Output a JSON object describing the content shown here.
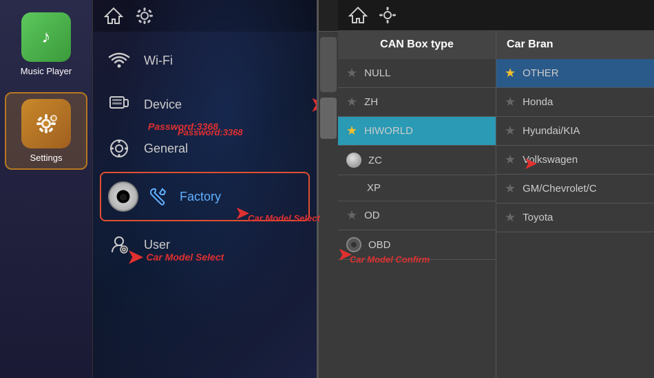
{
  "sidebar": {
    "apps": [
      {
        "id": "music-player",
        "label": "Music Player",
        "icon_type": "music",
        "active": false
      },
      {
        "id": "settings",
        "label": "Settings",
        "icon_type": "settings",
        "active": true
      }
    ]
  },
  "settings_panel": {
    "topbar": {
      "home_icon": "⌂",
      "gear_icon": "⚙"
    },
    "menu_items": [
      {
        "id": "wifi",
        "label": "Wi-Fi",
        "icon": "wifi"
      },
      {
        "id": "device",
        "label": "Device",
        "icon": "device"
      },
      {
        "id": "general",
        "label": "General",
        "icon": "general"
      },
      {
        "id": "factory",
        "label": "Factory",
        "icon": "factory",
        "active": true
      },
      {
        "id": "user",
        "label": "User",
        "icon": "user"
      }
    ],
    "password_hint": "Password:3368",
    "car_model_select_label": "Car Model Select",
    "car_model_confirm_label": "Car Model Confirm"
  },
  "can_box": {
    "header": "CAN Box type",
    "items": [
      {
        "id": "null",
        "label": "NULL",
        "icon": "star-dim",
        "selected": false
      },
      {
        "id": "zh",
        "label": "ZH",
        "icon": "star-dim",
        "selected": false
      },
      {
        "id": "hiworld",
        "label": "HIWORLD",
        "icon": "star-gold",
        "selected": true
      },
      {
        "id": "zc",
        "label": "ZC",
        "icon": "circle",
        "selected": false
      },
      {
        "id": "xp",
        "label": "XP",
        "icon": "none",
        "selected": false
      },
      {
        "id": "od",
        "label": "OD",
        "icon": "star-dim",
        "selected": false
      },
      {
        "id": "obd",
        "label": "OBD",
        "icon": "circle-dark",
        "selected": false
      }
    ]
  },
  "car_brand": {
    "header": "Car Bran",
    "items": [
      {
        "id": "other",
        "label": "OTHER",
        "icon": "star-gold",
        "selected": true
      },
      {
        "id": "honda",
        "label": "Honda",
        "icon": "star-dim",
        "selected": false
      },
      {
        "id": "hyundai",
        "label": "Hyundai/KIA",
        "icon": "star-dim",
        "selected": false
      },
      {
        "id": "volkswagen",
        "label": "Volkswagen",
        "icon": "star-dim",
        "selected": false
      },
      {
        "id": "gm",
        "label": "GM/Chevrolet/C",
        "icon": "star-dim",
        "selected": false
      },
      {
        "id": "toyota",
        "label": "Toyota",
        "icon": "star-dim",
        "selected": false
      }
    ]
  }
}
